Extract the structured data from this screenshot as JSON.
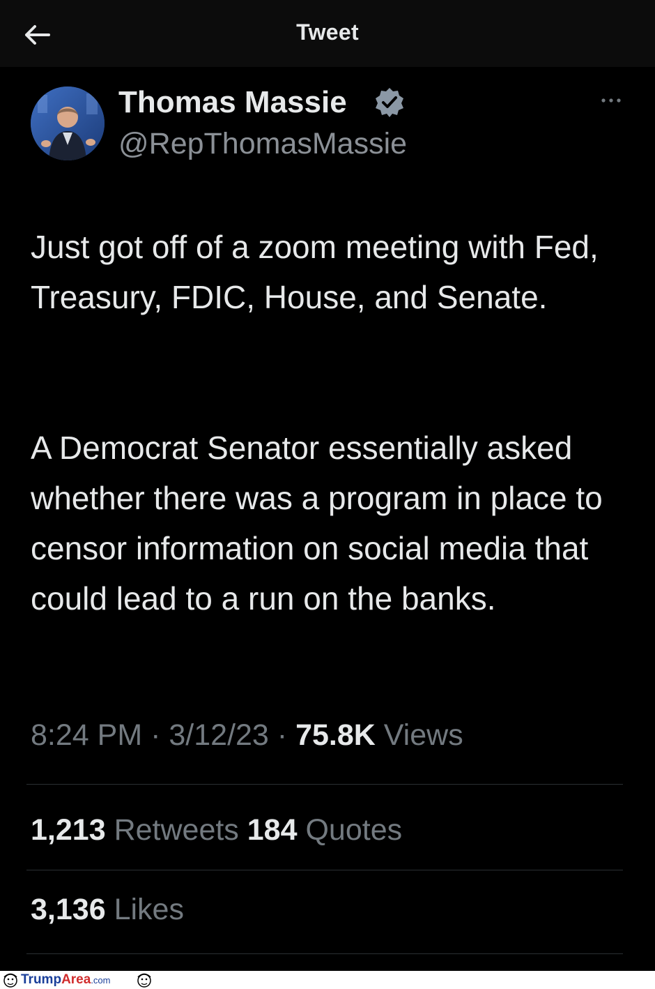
{
  "header": {
    "title": "Tweet",
    "back_icon": "arrow-left-icon"
  },
  "author": {
    "name": "Thomas Massie",
    "handle": "@RepThomasMassie",
    "verified_icon": "verified-badge-icon",
    "verified_color": "#8b98a5"
  },
  "tweet": {
    "paragraphs": [
      "Just got off of a zoom meeting with Fed, Treasury, FDIC, House, and Senate.",
      "A Democrat Senator essentially asked whether there was a program in place to censor information on social media that could lead to a run on the banks."
    ]
  },
  "meta": {
    "time": "8:24 PM",
    "separator": "·",
    "date": "3/12/23",
    "views_count": "75.8K",
    "views_label": "Views"
  },
  "stats": {
    "retweets_count": "1,213",
    "retweets_label": "Retweets",
    "quotes_count": "184",
    "quotes_label": "Quotes",
    "likes_count": "3,136",
    "likes_label": "Likes"
  },
  "watermark": {
    "part1": "Trump",
    "part2": "Area",
    "part3": ".com"
  },
  "colors": {
    "background": "#000000",
    "primary_text": "#e7e9ea",
    "secondary_text": "#737a80"
  }
}
